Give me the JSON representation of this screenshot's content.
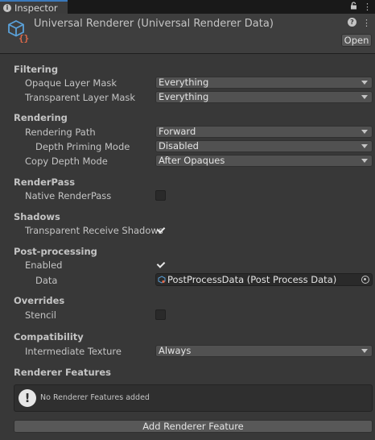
{
  "tab": {
    "label": "Inspector"
  },
  "header": {
    "title": "Universal Renderer (Universal Renderer Data)",
    "open_label": "Open"
  },
  "filtering": {
    "title": "Filtering",
    "opaque_label": "Opaque Layer Mask",
    "opaque_value": "Everything",
    "transparent_label": "Transparent Layer Mask",
    "transparent_value": "Everything"
  },
  "rendering": {
    "title": "Rendering",
    "path_label": "Rendering Path",
    "path_value": "Forward",
    "depth_priming_label": "Depth Priming Mode",
    "depth_priming_value": "Disabled",
    "copy_depth_label": "Copy Depth Mode",
    "copy_depth_value": "After Opaques"
  },
  "renderpass": {
    "title": "RenderPass",
    "native_label": "Native RenderPass",
    "native_checked": false
  },
  "shadows": {
    "title": "Shadows",
    "receive_label": "Transparent Receive Shadows",
    "receive_checked": true
  },
  "postprocessing": {
    "title": "Post-processing",
    "enabled_label": "Enabled",
    "enabled_checked": true,
    "data_label": "Data",
    "data_value": "PostProcessData (Post Process Data)"
  },
  "overrides": {
    "title": "Overrides",
    "stencil_label": "Stencil",
    "stencil_checked": false
  },
  "compatibility": {
    "title": "Compatibility",
    "intermediate_label": "Intermediate Texture",
    "intermediate_value": "Always"
  },
  "features": {
    "title": "Renderer Features",
    "empty_message": "No Renderer Features added",
    "add_label": "Add Renderer Feature"
  },
  "colors": {
    "background": "#383838",
    "accent": "#3a79bb",
    "text": "#c4c4c4"
  }
}
